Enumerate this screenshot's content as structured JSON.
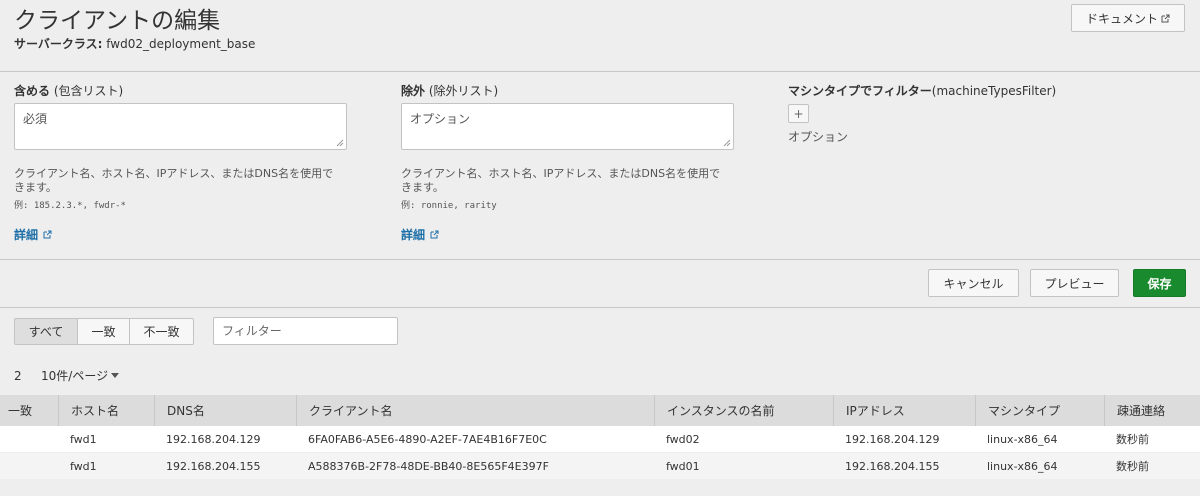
{
  "header": {
    "title": "クライアントの編集",
    "server_class_label": "サーバークラス:",
    "server_class_value": "fwd02_deployment_base",
    "doc_button_label": "ドキュメント"
  },
  "include": {
    "label_bold": "含める",
    "label_rest": "(包含リスト)",
    "placeholder": "必須",
    "help": "クライアント名、ホスト名、IPアドレス、またはDNS名を使用できます。",
    "example": "例: 185.2.3.*, fwdr-*",
    "detail_link": "詳細"
  },
  "exclude": {
    "label_bold": "除外",
    "label_rest": "(除外リスト)",
    "placeholder": "オプション",
    "help": "クライアント名、ホスト名、IPアドレス、またはDNS名を使用できます。",
    "example": "例: ronnie, rarity",
    "detail_link": "詳細"
  },
  "machine_filter": {
    "label_bold": "マシンタイプでフィルター",
    "label_rest": "(machineTypesFilter)",
    "add_label": "+",
    "option_label": "オプション"
  },
  "actions": {
    "cancel": "キャンセル",
    "preview": "プレビュー",
    "save": "保存"
  },
  "match_filter": {
    "options": [
      "すべて",
      "一致",
      "不一致"
    ],
    "selected": "すべて",
    "filter_placeholder": "フィルター"
  },
  "pagination": {
    "count": "2",
    "per_page": "10件/ページ"
  },
  "table": {
    "columns": [
      "一致",
      "ホスト名",
      "DNS名",
      "クライアント名",
      "インスタンスの名前",
      "IPアドレス",
      "マシンタイプ",
      "疎通連絡"
    ],
    "rows": [
      [
        "",
        "fwd1",
        "192.168.204.129",
        "6FA0FAB6-A5E6-4890-A2EF-7AE4B16F7E0C",
        "fwd02",
        "192.168.204.129",
        "linux-x86_64",
        "数秒前"
      ],
      [
        "",
        "fwd1",
        "192.168.204.155",
        "A588376B-2F78-48DE-BB40-8E565F4E397F",
        "fwd01",
        "192.168.204.155",
        "linux-x86_64",
        "数秒前"
      ]
    ]
  },
  "colors": {
    "save_button": "#1a8a2e",
    "link": "#1e6fa8"
  }
}
